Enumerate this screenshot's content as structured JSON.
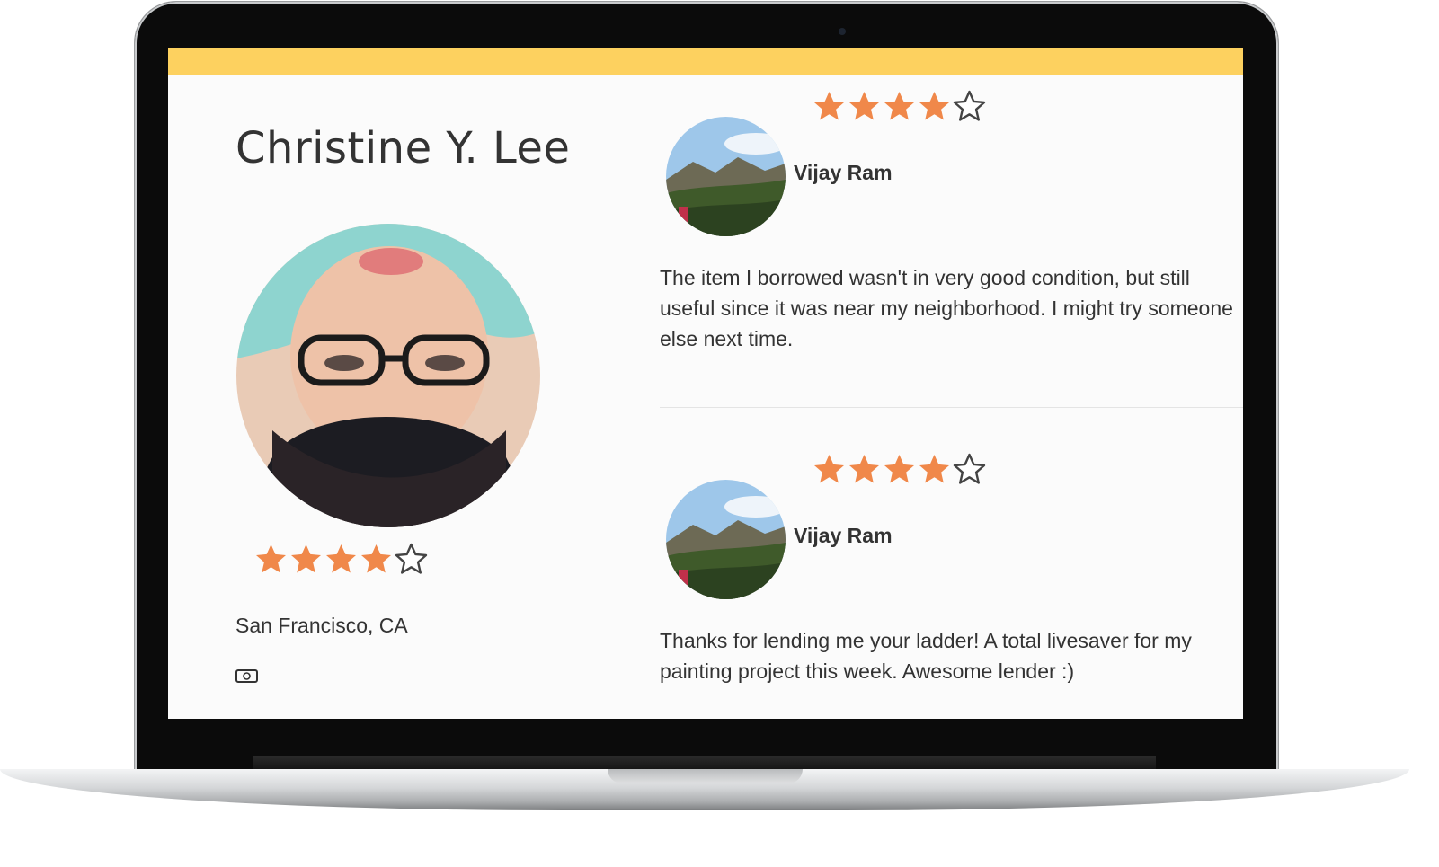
{
  "profile": {
    "name": "Christine Y. Lee",
    "rating": 4,
    "rating_max": 5,
    "location": "San Francisco, CA",
    "payment_icon": "money-icon"
  },
  "reviews": [
    {
      "rating": 4,
      "rating_max": 5,
      "reviewer": "Vijay Ram",
      "text": "The item I borrowed wasn't in very good condition, but still useful since it was near my neighborhood. I might try someone else next time."
    },
    {
      "rating": 4,
      "rating_max": 5,
      "reviewer": "Vijay Ram",
      "text": "Thanks for lending me your ladder! A total livesaver for my painting project this week. Awesome lender :)"
    }
  ],
  "colors": {
    "accent_bar": "#fdd15f",
    "star_filled": "#f0884a",
    "star_empty_outline": "#444444",
    "text": "#333333"
  }
}
